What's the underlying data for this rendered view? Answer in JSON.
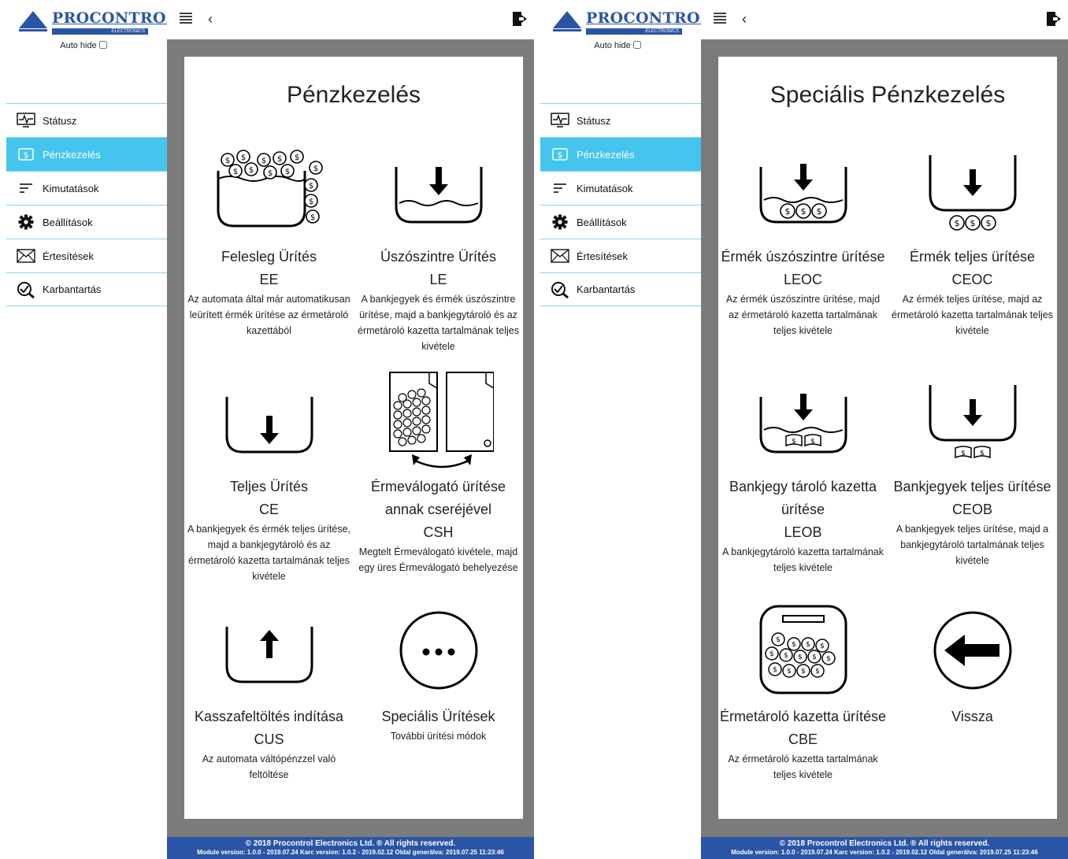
{
  "brand": {
    "name": "PROCONTROL",
    "sub": "ELECTRONICS"
  },
  "autohide_label": "Auto hide",
  "menu": [
    {
      "label": "Státusz",
      "icon": "monitor-pulse-icon"
    },
    {
      "label": "Pénzkezelés",
      "icon": "money-icon"
    },
    {
      "label": "Kimutatások",
      "icon": "list-lines-icon"
    },
    {
      "label": "Beállítások",
      "icon": "gear-icon"
    },
    {
      "label": "Értesítések",
      "icon": "envelope-icon"
    },
    {
      "label": "Karbantartás",
      "icon": "wrench-check-icon"
    }
  ],
  "active_menu_index": 1,
  "left_page": {
    "title": "Pénzkezelés",
    "tiles": [
      {
        "name": "Felesleg Ürítés",
        "code": "EE",
        "desc": "Az automata által már automatikusan leürített érmék ürítése az érmetároló kazettából"
      },
      {
        "name": "Úszószintre Ürítés",
        "code": "LE",
        "desc": "A bankjegyek és érmék úszószintre ürítése, majd a bankjegytároló és az érmetároló kazetta tartalmának teljes kivétele"
      },
      {
        "name": "Teljes Ürítés",
        "code": "CE",
        "desc": "A bankjegyek és érmék teljes ürítése, majd a bankjegytároló és az érmetároló kazetta tartalmának teljes kivétele"
      },
      {
        "name": "Érmeválogató ürítése annak cseréjével",
        "code": "CSH",
        "desc": "Megtelt Érmeválogató kivétele, majd egy üres Érmeválogató behelyezése"
      },
      {
        "name": "Kasszafeltöltés indítása",
        "code": "CUS",
        "desc": "Az automata váltópénzzel való feltöltése"
      },
      {
        "name": "Speciális Ürítések",
        "code": "",
        "desc": "További ürítési módok"
      }
    ]
  },
  "right_page": {
    "title": "Speciális Pénzkezelés",
    "tiles": [
      {
        "name": "Érmék úszószintre ürítése",
        "code": "LEOC",
        "desc": "Az érmék úszószintre ürítése, majd az érmetároló kazetta tartalmának teljes kivétele"
      },
      {
        "name": "Érmék teljes ürítése",
        "code": "CEOC",
        "desc": "Az érmék teljes ürítése, majd az érmetároló kazetta tartalmának teljes kivétele"
      },
      {
        "name": "Bankjegy tároló kazetta ürítése",
        "code": "LEOB",
        "desc": "A bankjegytároló kazetta tartalmának teljes kivétele"
      },
      {
        "name": "Bankjegyek teljes ürítése",
        "code": "CEOB",
        "desc": "A bankjegyek teljes ürítése, majd a bankjegytároló tartalmának teljes kivétele"
      },
      {
        "name": "Érmetároló kazetta ürítése",
        "code": "CBE",
        "desc": "Az érmetároló kazetta tartalmának teljes kivétele"
      },
      {
        "name": "Vissza",
        "code": "",
        "desc": ""
      }
    ]
  },
  "footer": {
    "copyright": "© 2018 Procontrol Electronics Ltd. ® All rights reserved.",
    "versions": "Module version: 1.0.0 - 2019.07.24    Karc version: 1.0.2 - 2019.02.12    Oldal generálva: 2019.07.25 11:23:46"
  },
  "colors": {
    "accent": "#45c4ee",
    "brand_blue": "#2a55a6",
    "divider": "#7fd3ef",
    "backdrop": "#7b7b7b"
  }
}
